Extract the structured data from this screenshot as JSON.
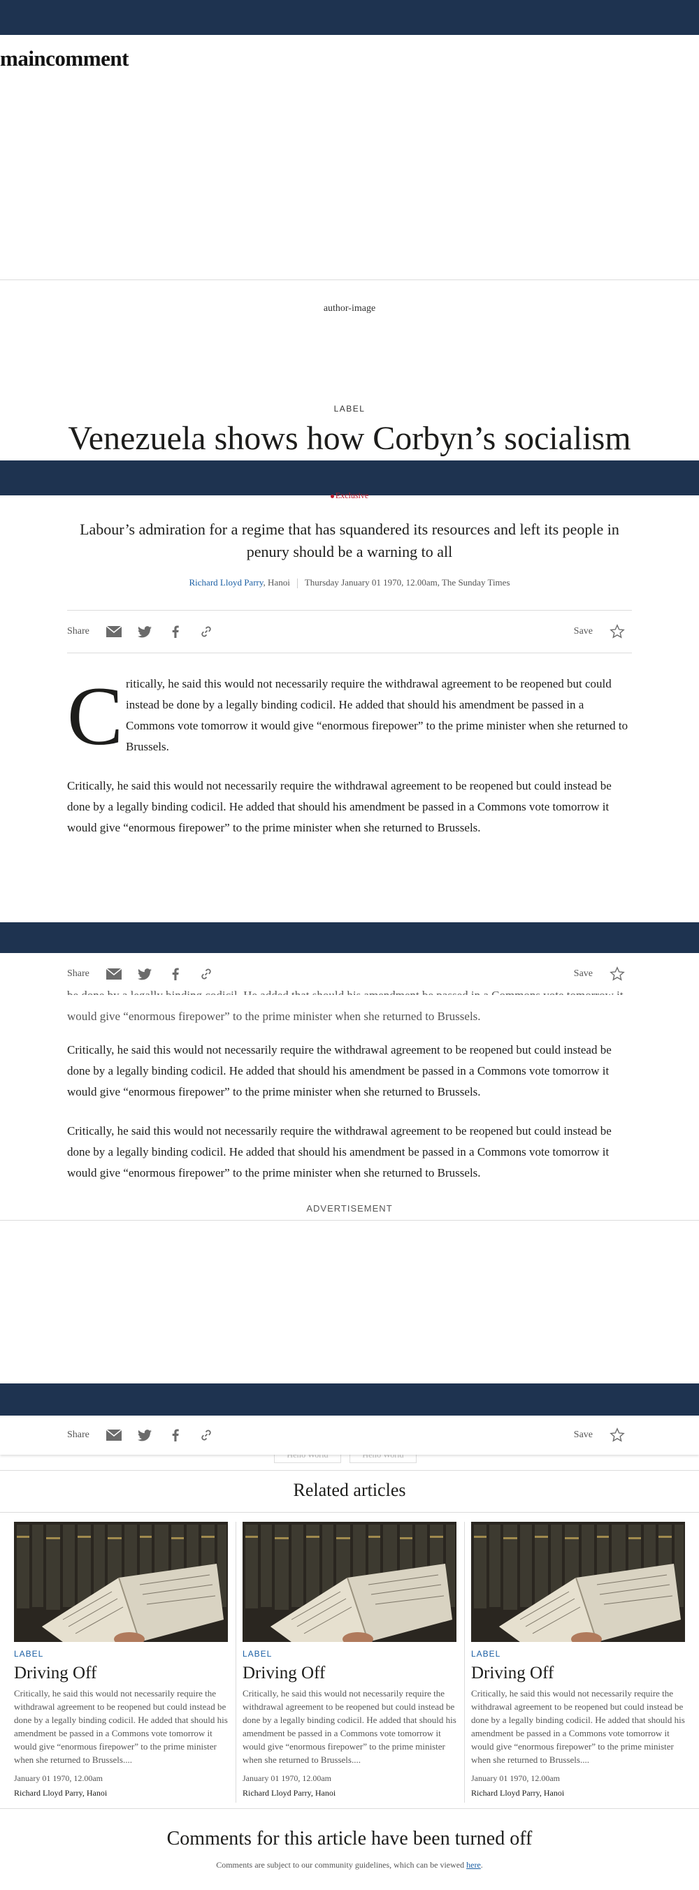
{
  "site": {
    "brand": "maincomment"
  },
  "article": {
    "author_image_alt": "author-image",
    "label": "LABEL",
    "headline": "Venezuela shows how Corbyn’s socialism",
    "flag": "Exclusive",
    "standfirst": "Labour’s admiration for a regime that has squandered its resources and left its people in penury should be a warning to all",
    "byline": {
      "author": "Richard Lloyd Parry",
      "location": ", Hanoi",
      "date": "Thursday January 01 1970, 12.00am, The Sunday Times"
    },
    "dropcap": "C",
    "dropcap_paragraph": "ritically, he said this would not necessarily require the withdrawal agreement to be reopened but could instead be done by a legally binding codicil. He added that should his amendment be passed in a Commons vote tomorrow it would give “enormous firepower” to the prime minister when she returned to Brussels.",
    "paragraphs": [
      "Critically, he said this would not necessarily require the withdrawal agreement to be reopened but could instead be done by a legally binding codicil. He added that should his amendment be passed in a Commons vote tomorrow it would give “enormous firepower” to the prime minister when she returned to Brussels.",
      "be done by a legally binding codicil. He added that should his amendment be passed in a Commons vote tomorrow it would give “enormous firepower” to the prime minister when she returned to Brussels.",
      "Critically, he said this would not necessarily require the withdrawal agreement to be reopened but could instead be done by a legally binding codicil. He added that should his amendment be passed in a Commons vote tomorrow it would give “enormous firepower” to the prime minister when she returned to Brussels.",
      "Critically, he said this would not necessarily require the withdrawal agreement to be reopened but could instead be done by a legally binding codicil. He added that should his amendment be passed in a Commons vote tomorrow it would give “enormous firepower” to the prime minister when she returned to Brussels."
    ]
  },
  "share": {
    "label": "Share",
    "save_label": "Save",
    "icons": [
      "email-icon",
      "twitter-icon",
      "facebook-icon",
      "link-icon",
      "star-icon"
    ]
  },
  "advert": {
    "label": "ADVERTISEMENT"
  },
  "tags": [
    "Hello World",
    "Hello World"
  ],
  "related": {
    "title": "Related articles",
    "cards": [
      {
        "label": "LABEL",
        "title": "Driving Off",
        "summary": "Critically, he said this would not necessarily require the withdrawal agreement to be reopened but could instead be done by a legally binding codicil. He added that should his amendment be passed in a Commons vote tomorrow it would give “enormous firepower” to the prime minister when she returned to Brussels....",
        "date": "January 01 1970, 12.00am",
        "author": "Richard Lloyd Parry, Hanoi"
      },
      {
        "label": "LABEL",
        "title": "Driving Off",
        "summary": "Critically, he said this would not necessarily require the withdrawal agreement to be reopened but could instead be done by a legally binding codicil. He added that should his amendment be passed in a Commons vote tomorrow it would give “enormous firepower” to the prime minister when she returned to Brussels....",
        "date": "January 01 1970, 12.00am",
        "author": "Richard Lloyd Parry, Hanoi"
      },
      {
        "label": "LABEL",
        "title": "Driving Off",
        "summary": "Critically, he said this would not necessarily require the withdrawal agreement to be reopened but could instead be done by a legally binding codicil. He added that should his amendment be passed in a Commons vote tomorrow it would give “enormous firepower” to the prime minister when she returned to Brussels....",
        "date": "January 01 1970, 12.00am",
        "author": "Richard Lloyd Parry, Hanoi"
      }
    ]
  },
  "comments": {
    "title": "Comments for this article have been turned off",
    "note": "Comments are subject to our community guidelines, which can be viewed ",
    "link_text": "here",
    "note_end": "."
  },
  "colors": {
    "navy": "#1e3350",
    "link_blue": "#1b5fa4",
    "exclusive_red": "#c21c2c"
  }
}
